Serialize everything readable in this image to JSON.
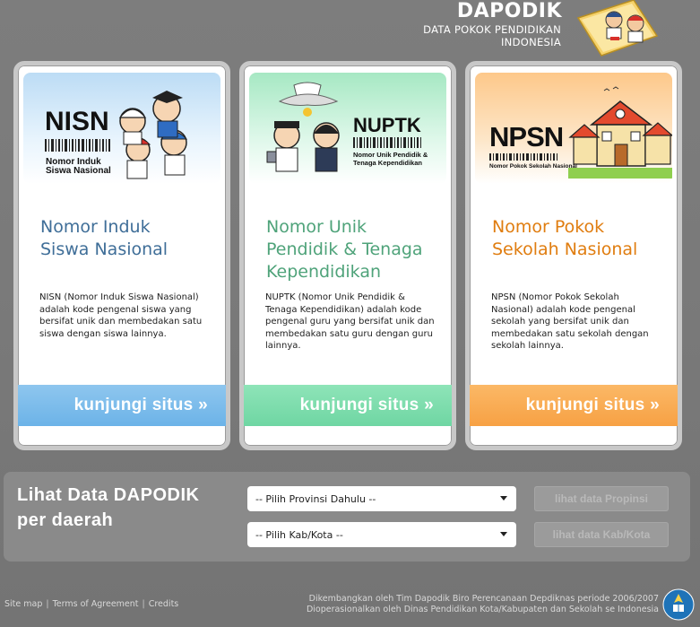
{
  "header": {
    "title": "DAPODIK",
    "subtitle_line1": "DATA POKOK PENDIDIKAN",
    "subtitle_line2": "INDONESIA"
  },
  "cards": [
    {
      "id": "nisn",
      "banner_word": "NISN",
      "banner_caption_line1": "Nomor Induk",
      "banner_caption_line2": "Siswa Nasional",
      "title_line1": "Nomor Induk",
      "title_line2": "Siswa Nasional",
      "title_line3": "",
      "description": "NISN (Nomor Induk Siswa Nasional) adalah kode pengenal siswa yang bersifat unik dan membedakan satu siswa dengan siswa lainnya.",
      "visit_label": "kunjungi situs »",
      "accent": "#6cb3e8"
    },
    {
      "id": "nuptk",
      "banner_word": "NUPTK",
      "banner_caption_line1": "Nomor Unik Pendidik &",
      "banner_caption_line2": "Tenaga Kependidikan",
      "title_line1": "Nomor Unik",
      "title_line2": "Pendidik & Tenaga",
      "title_line3": "Kependidikan",
      "description": "NUPTK (Nomor Unik Pendidik & Tenaga Kependidikan) adalah kode pengenal guru yang bersifat unik dan membedakan satu guru dengan guru lainnya.",
      "visit_label": "kunjungi situs »",
      "accent": "#6fd6a3"
    },
    {
      "id": "npsn",
      "banner_word": "NPSN",
      "banner_caption_line1": "Nomor Pokok Sekolah Nasional",
      "banner_caption_line2": "",
      "title_line1": "Nomor Pokok",
      "title_line2": "Sekolah Nasional",
      "title_line3": "",
      "description": "NPSN (Nomor Pokok Sekolah Nasional) adalah kode pengenal sekolah yang bersifat unik dan membedakan satu sekolah dengan sekolah lainnya.",
      "visit_label": "kunjungi situs »",
      "accent": "#f7a144"
    }
  ],
  "data_panel": {
    "title_line1": "Lihat Data DAPODIK",
    "title_line2": "per daerah",
    "province_select": "-- Pilih Provinsi Dahulu --",
    "kab_select": "-- Pilih Kab/Kota --",
    "province_button": "lihat data Propinsi",
    "kab_button": "lihat data Kab/Kota"
  },
  "footer": {
    "links": [
      "Site map",
      "Terms of Agreement",
      "Credits"
    ],
    "credit_line1": "Dikembangkan oleh Tim Dapodik Biro Perencanaan Depdiknas periode 2006/2007",
    "credit_line2": "Dioperasionalkan oleh Dinas Pendidikan Kota/Kabupaten dan Sekolah se Indonesia"
  }
}
